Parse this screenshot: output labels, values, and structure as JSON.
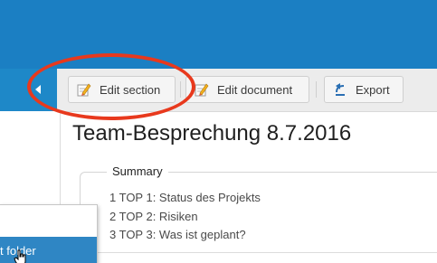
{
  "toolbar": {
    "edit_section_label": "Edit section",
    "edit_document_label": "Edit document",
    "export_label": "Export"
  },
  "document": {
    "title": "Team-Besprechung 8.7.2016"
  },
  "summary": {
    "heading": "Summary",
    "items": [
      "1 TOP 1: Status des Projekts",
      "2 TOP 2: Risiken",
      "3 TOP 3: Was ist geplant?"
    ]
  },
  "context_menu": {
    "highlighted_item_label": "t folder"
  },
  "colors": {
    "header_blue": "#1b7fc3",
    "toolbar_bg": "#ececec",
    "highlight_red": "#e8391d",
    "menu_highlight": "#2f86c4"
  },
  "icons": {
    "edit": "pencil-note-icon",
    "export": "export-arrow-icon",
    "collapse": "chevron-left-icon"
  }
}
